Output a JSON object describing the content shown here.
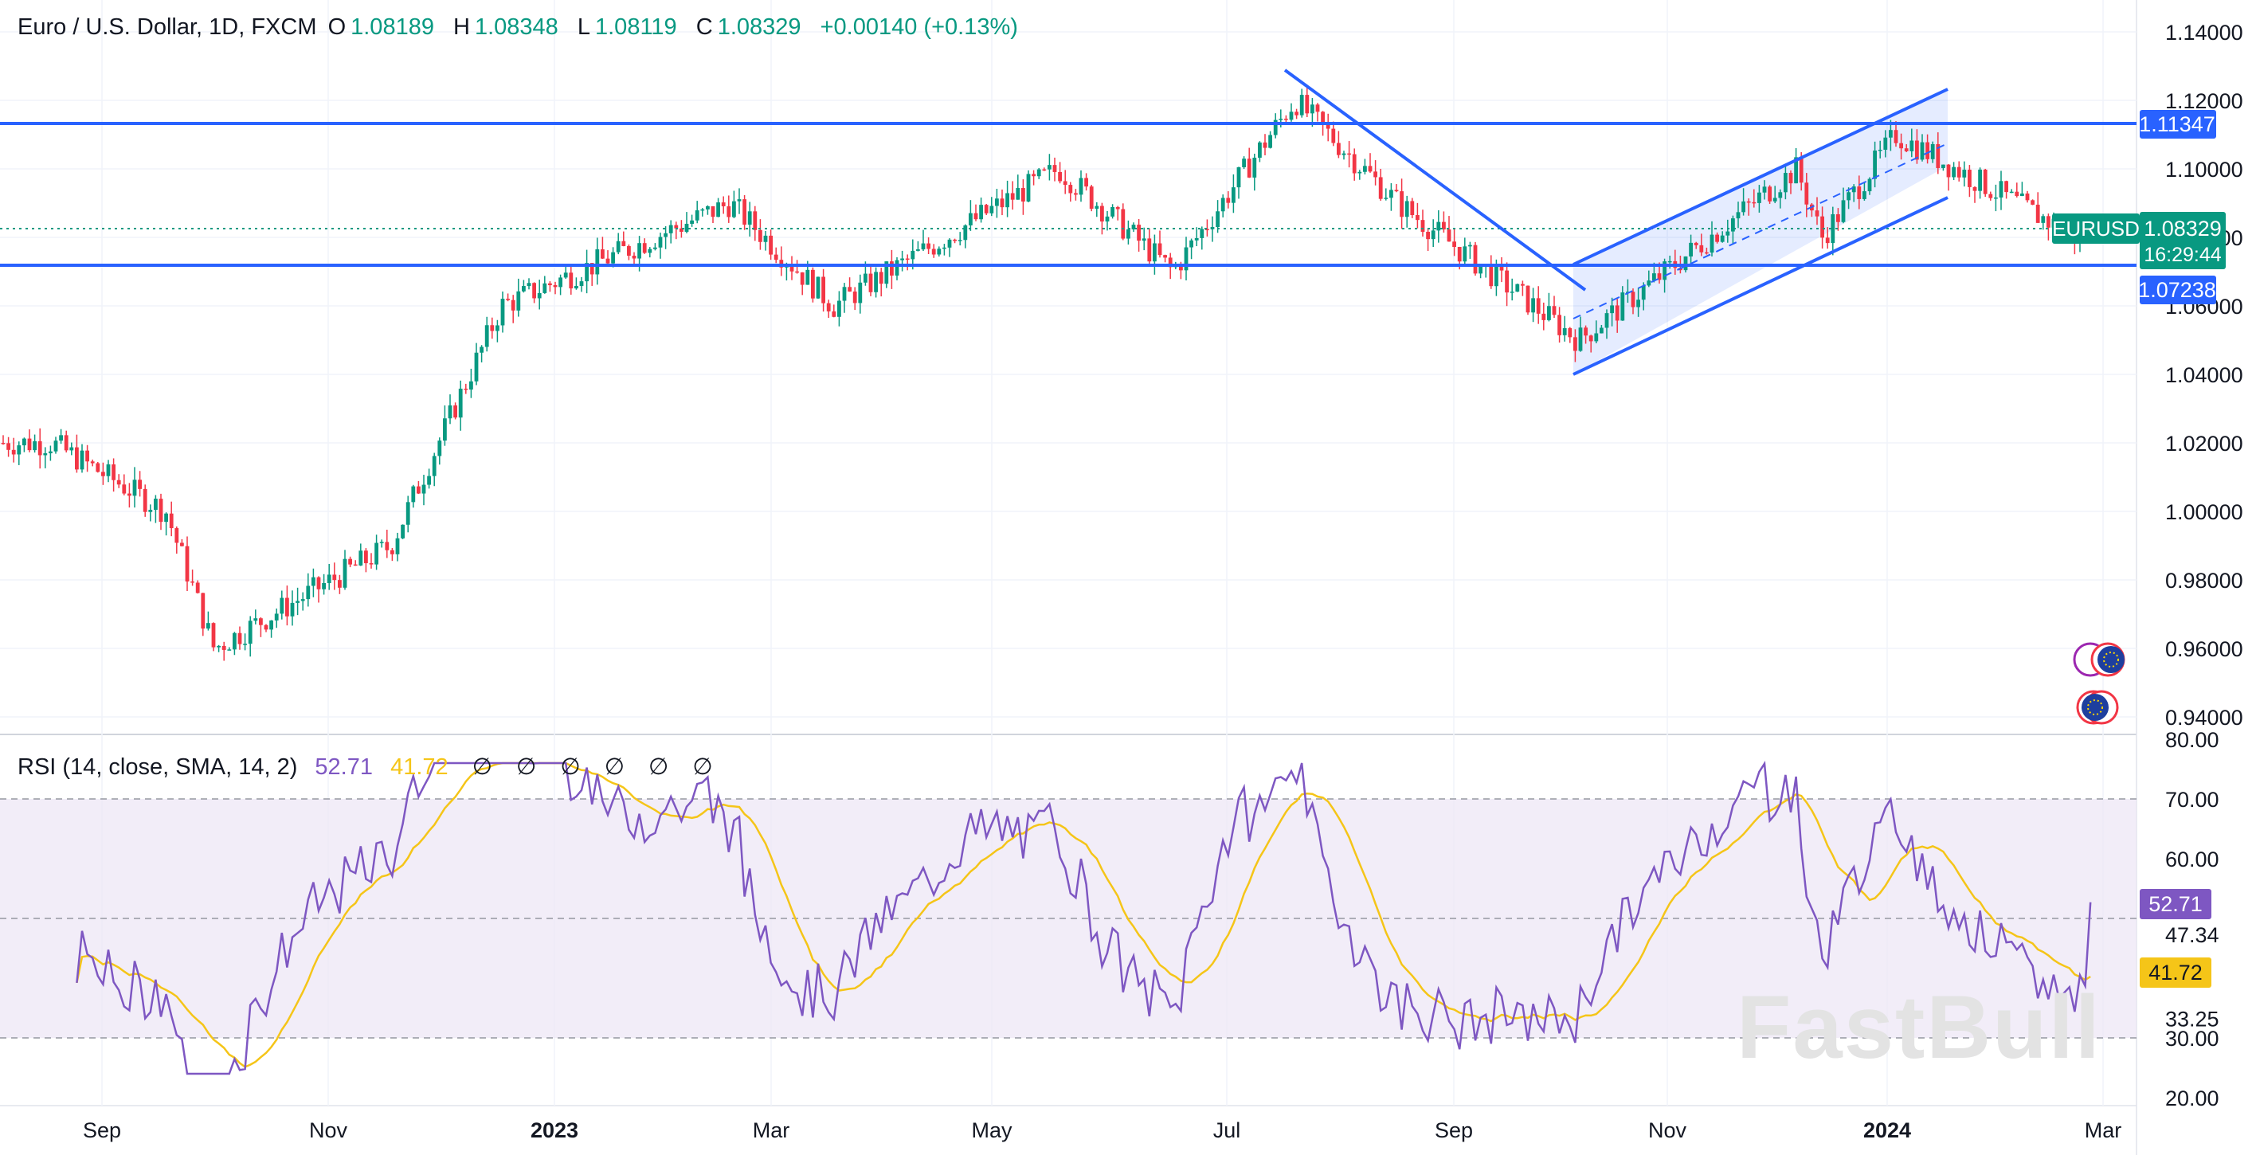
{
  "header": {
    "symbol": "Euro / U.S. Dollar, 1D, FXCM",
    "open_label": "O",
    "open": "1.08189",
    "high_label": "H",
    "high": "1.08348",
    "low_label": "L",
    "low": "1.08119",
    "close_label": "C",
    "close": "1.08329",
    "change": "+0.00140 (+0.13%)"
  },
  "price_axis": [
    "1.14000",
    "1.12000",
    "1.10000",
    "1.08000",
    "1.06000",
    "1.04000",
    "1.02000",
    "1.00000",
    "0.98000",
    "0.96000",
    "0.94000"
  ],
  "price_tags": {
    "resistance": "1.11347",
    "support": "1.07238",
    "symbol": "EURUSD",
    "last": "1.08329",
    "countdown": "16:29:44"
  },
  "rsi": {
    "title": "RSI (14, close, SMA, 14, 2)",
    "value": "52.71",
    "ma_value": "41.72",
    "off_markers": [
      "∅",
      "∅",
      "∅",
      "∅",
      "∅",
      "∅"
    ],
    "axis": [
      "80.00",
      "70.00",
      "60.00",
      "47.34",
      "33.25",
      "30.00",
      "20.00"
    ]
  },
  "time_axis": [
    "Sep",
    "Nov",
    "2023",
    "Mar",
    "May",
    "Jul",
    "Sep",
    "Nov",
    "2024",
    "Mar"
  ],
  "watermark": "FastBull",
  "colors": {
    "up": "#089981",
    "down": "#f23645",
    "line": "#2962ff",
    "rsi": "#7e57c2",
    "rsi_ma": "#f5c518",
    "band": "#ede7f6"
  },
  "chart_data": {
    "type": "candlestick",
    "title": "Euro / U.S. Dollar, 1D, FXCM",
    "x_range": [
      "2022-08",
      "2024-02"
    ],
    "ylim": [
      0.935,
      1.145
    ],
    "horizontal_levels": [
      1.11347,
      1.07238
    ],
    "last_price": 1.08329,
    "approx_close_path": [
      {
        "date": "2022-08",
        "close": 1.02
      },
      {
        "date": "2022-09",
        "close": 1.0
      },
      {
        "date": "2022-09-28",
        "close": 0.96
      },
      {
        "date": "2022-11",
        "close": 0.99
      },
      {
        "date": "2022-12",
        "close": 1.06
      },
      {
        "date": "2023-02",
        "close": 1.09
      },
      {
        "date": "2023-03",
        "close": 1.06
      },
      {
        "date": "2023-05",
        "close": 1.1
      },
      {
        "date": "2023-06",
        "close": 1.07
      },
      {
        "date": "2023-07-18",
        "close": 1.12
      },
      {
        "date": "2023-08",
        "close": 1.09
      },
      {
        "date": "2023-10-03",
        "close": 1.05
      },
      {
        "date": "2023-12-01",
        "close": 1.1
      },
      {
        "date": "2023-12-08",
        "close": 1.08
      },
      {
        "date": "2023-12-28",
        "close": 1.11
      },
      {
        "date": "2024-02",
        "close": 1.08
      }
    ],
    "rsi": {
      "period": 14,
      "levels": [
        70,
        30
      ],
      "last": 52.71,
      "ma_last": 41.72
    }
  }
}
